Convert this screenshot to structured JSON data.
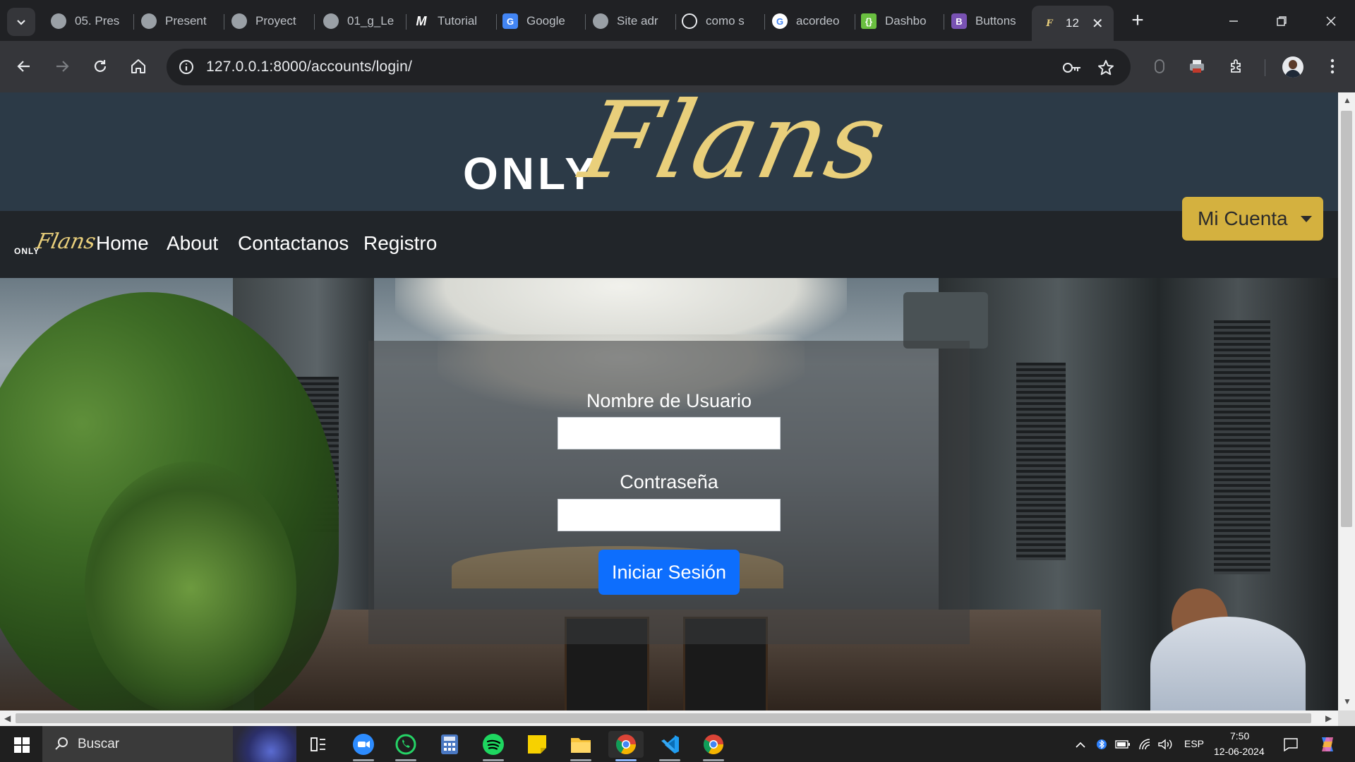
{
  "browser": {
    "tabs": [
      {
        "label": "05. Pres",
        "icon": "globe-icon"
      },
      {
        "label": "Present",
        "icon": "globe-icon"
      },
      {
        "label": "Proyect",
        "icon": "globe-icon"
      },
      {
        "label": "01_g_Le",
        "icon": "globe-icon"
      },
      {
        "label": "Tutorial",
        "icon": "m-logo-icon"
      },
      {
        "label": "Google",
        "icon": "google-translate-icon"
      },
      {
        "label": "Site adr",
        "icon": "globe-icon"
      },
      {
        "label": "como s",
        "icon": "chatgpt-icon"
      },
      {
        "label": "acordeo",
        "icon": "google-icon"
      },
      {
        "label": "Dashbo",
        "icon": "bracket-logo-icon"
      },
      {
        "label": "Buttons",
        "icon": "bootstrap-icon"
      },
      {
        "label": "12",
        "icon": "onlyflans-icon",
        "active": true
      }
    ],
    "url": "127.0.0.1:8000/accounts/login/"
  },
  "site": {
    "logo_only": "ONLY",
    "logo_flans": "Flans",
    "brand_only": "ONLY",
    "brand_flans": "Flans",
    "nav": [
      {
        "label": "Home"
      },
      {
        "label": "About"
      },
      {
        "label": "Contactanos"
      },
      {
        "label": "Registro"
      }
    ],
    "account_button": "Mi Cuenta"
  },
  "login_form": {
    "username_label": "Nombre de Usuario",
    "username_value": "",
    "password_label": "Contraseña",
    "password_value": "",
    "submit_label": "Iniciar Sesión"
  },
  "taskbar": {
    "search_placeholder": "Buscar",
    "apps": [
      "zoom",
      "whatsapp",
      "calculator",
      "spotify",
      "sticky-notes",
      "file-explorer",
      "chrome",
      "vscode",
      "chrome-alt"
    ],
    "language": "ESP",
    "time": "7:50",
    "date": "12-06-2024"
  },
  "colors": {
    "banner": "#2c3a47",
    "navbar": "#212529",
    "gold": "#e9cf7b",
    "account_button": "#d4b13f",
    "primary_button": "#0d6efd"
  }
}
